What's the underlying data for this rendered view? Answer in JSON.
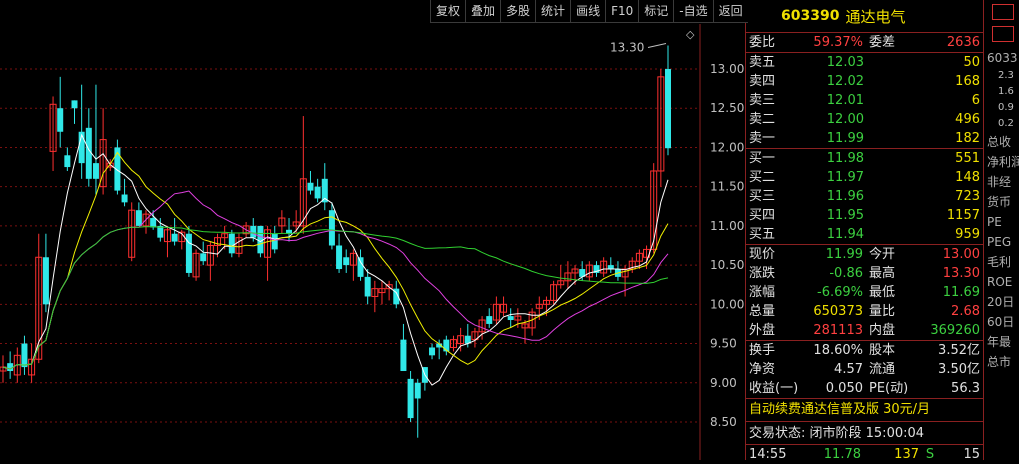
{
  "toolbar": [
    "复权",
    "叠加",
    "多股",
    "统计",
    "画线",
    "F10",
    "标记",
    "-自选",
    "返回"
  ],
  "chart_data": {
    "type": "candlestick",
    "ylim": [
      8.3,
      13.6
    ],
    "yticks": [
      "13.00",
      "12.50",
      "12.00",
      "11.50",
      "11.00",
      "10.50",
      "10.00",
      "9.50",
      "9.00",
      "8.50"
    ],
    "high_annotation": "13.30",
    "candles": [
      [
        9.15,
        9.35,
        9.0,
        9.2
      ],
      [
        9.25,
        9.4,
        9.05,
        9.15
      ],
      [
        9.1,
        9.45,
        9.0,
        9.35
      ],
      [
        9.5,
        9.6,
        9.1,
        9.2
      ],
      [
        9.1,
        9.5,
        9.0,
        9.3
      ],
      [
        9.3,
        10.9,
        9.25,
        10.6
      ],
      [
        10.6,
        10.9,
        9.9,
        10.0
      ],
      [
        11.95,
        12.65,
        11.7,
        12.55
      ],
      [
        12.5,
        12.9,
        12.0,
        12.2
      ],
      [
        11.9,
        12.0,
        11.7,
        11.75
      ],
      [
        12.6,
        12.6,
        12.3,
        12.5
      ],
      [
        12.2,
        12.8,
        11.6,
        11.8
      ],
      [
        12.25,
        12.5,
        11.5,
        11.6
      ],
      [
        11.8,
        12.8,
        11.4,
        11.6
      ],
      [
        11.5,
        12.5,
        11.4,
        12.1
      ],
      [
        11.75,
        11.85,
        11.7,
        11.8
      ],
      [
        12.0,
        12.1,
        11.4,
        11.45
      ],
      [
        11.4,
        11.6,
        11.25,
        11.3
      ],
      [
        10.6,
        11.3,
        10.55,
        11.2
      ],
      [
        11.2,
        11.3,
        11.0,
        11.0
      ],
      [
        11.0,
        11.2,
        10.9,
        11.15
      ],
      [
        11.1,
        11.2,
        10.95,
        10.98
      ],
      [
        11.0,
        11.1,
        10.8,
        10.85
      ],
      [
        10.8,
        11.0,
        10.6,
        10.95
      ],
      [
        10.9,
        11.1,
        10.75,
        10.8
      ],
      [
        10.8,
        10.95,
        10.7,
        10.92
      ],
      [
        10.9,
        11.0,
        10.35,
        10.4
      ],
      [
        10.35,
        10.7,
        10.3,
        10.65
      ],
      [
        10.65,
        10.8,
        10.5,
        10.55
      ],
      [
        10.5,
        10.8,
        10.3,
        10.75
      ],
      [
        10.75,
        10.9,
        10.6,
        10.85
      ],
      [
        10.85,
        11.0,
        10.7,
        10.9
      ],
      [
        10.9,
        10.95,
        10.6,
        10.65
      ],
      [
        10.65,
        10.9,
        10.6,
        10.85
      ],
      [
        10.9,
        11.05,
        10.85,
        11.0
      ],
      [
        11.0,
        11.1,
        10.8,
        10.85
      ],
      [
        11.0,
        11.0,
        10.6,
        10.65
      ],
      [
        10.6,
        11.0,
        10.3,
        10.95
      ],
      [
        10.9,
        11.0,
        10.65,
        10.7
      ],
      [
        11.0,
        11.2,
        10.9,
        11.1
      ],
      [
        10.95,
        11.1,
        10.8,
        10.9
      ],
      [
        11.0,
        11.2,
        10.9,
        11.05
      ],
      [
        11.0,
        12.4,
        10.9,
        11.6
      ],
      [
        11.55,
        11.7,
        11.4,
        11.45
      ],
      [
        11.5,
        11.6,
        11.3,
        11.35
      ],
      [
        11.6,
        11.8,
        11.2,
        11.3
      ],
      [
        11.2,
        11.3,
        10.7,
        10.75
      ],
      [
        10.75,
        10.9,
        10.4,
        10.45
      ],
      [
        10.6,
        10.7,
        10.4,
        10.5
      ],
      [
        10.5,
        10.7,
        10.3,
        10.65
      ],
      [
        10.6,
        10.7,
        10.3,
        10.35
      ],
      [
        10.35,
        10.45,
        10.0,
        10.1
      ],
      [
        10.1,
        10.3,
        9.9,
        10.2
      ],
      [
        10.15,
        10.3,
        10.0,
        10.2
      ],
      [
        10.2,
        10.3,
        10.05,
        10.25
      ],
      [
        10.2,
        10.3,
        9.95,
        10.0
      ],
      [
        9.55,
        9.75,
        9.15,
        9.15
      ],
      [
        9.05,
        9.15,
        8.5,
        8.55
      ],
      [
        9.0,
        9.05,
        8.3,
        8.8
      ],
      [
        9.2,
        9.2,
        8.9,
        9.0
      ],
      [
        9.45,
        9.5,
        9.3,
        9.35
      ],
      [
        9.5,
        9.55,
        9.3,
        9.45
      ],
      [
        9.55,
        9.6,
        9.35,
        9.4
      ],
      [
        9.45,
        9.6,
        9.4,
        9.55
      ],
      [
        9.5,
        9.7,
        9.4,
        9.6
      ],
      [
        9.6,
        9.75,
        9.45,
        9.5
      ],
      [
        9.55,
        9.7,
        9.45,
        9.65
      ],
      [
        9.65,
        9.85,
        9.55,
        9.8
      ],
      [
        9.85,
        9.95,
        9.7,
        9.75
      ],
      [
        9.8,
        10.1,
        9.75,
        10.0
      ],
      [
        9.9,
        10.1,
        9.85,
        10.0
      ],
      [
        9.85,
        9.95,
        9.7,
        9.8
      ],
      [
        9.8,
        9.95,
        9.7,
        9.85
      ],
      [
        9.7,
        9.8,
        9.5,
        9.75
      ],
      [
        9.7,
        9.95,
        9.6,
        9.9
      ],
      [
        9.95,
        10.1,
        9.8,
        10.0
      ],
      [
        10.0,
        10.1,
        9.85,
        10.05
      ],
      [
        10.05,
        10.3,
        10.0,
        10.25
      ],
      [
        10.25,
        10.5,
        10.2,
        10.3
      ],
      [
        10.3,
        10.55,
        10.2,
        10.4
      ],
      [
        10.4,
        10.5,
        10.25,
        10.45
      ],
      [
        10.45,
        10.55,
        10.3,
        10.35
      ],
      [
        10.35,
        10.55,
        10.3,
        10.5
      ],
      [
        10.5,
        10.55,
        10.35,
        10.4
      ],
      [
        10.4,
        10.6,
        10.35,
        10.55
      ],
      [
        10.5,
        10.6,
        10.4,
        10.45
      ],
      [
        10.45,
        10.55,
        10.3,
        10.35
      ],
      [
        10.35,
        10.5,
        10.1,
        10.45
      ],
      [
        10.45,
        10.6,
        10.4,
        10.55
      ],
      [
        10.55,
        10.7,
        10.45,
        10.65
      ],
      [
        10.6,
        10.75,
        10.45,
        10.7
      ],
      [
        10.7,
        11.8,
        10.65,
        11.7
      ],
      [
        11.7,
        13.0,
        11.5,
        12.9
      ],
      [
        13.0,
        13.3,
        11.9,
        11.99
      ]
    ]
  },
  "quote": {
    "code": "603390",
    "name": "通达电气",
    "weibi_label": "委比",
    "weibi_value": "59.37%",
    "weicha_label": "委差",
    "weicha_value": "2636",
    "asks": [
      {
        "label": "卖五",
        "price": "12.03",
        "vol": "50"
      },
      {
        "label": "卖四",
        "price": "12.02",
        "vol": "168"
      },
      {
        "label": "卖三",
        "price": "12.01",
        "vol": "6"
      },
      {
        "label": "卖二",
        "price": "12.00",
        "vol": "496"
      },
      {
        "label": "卖一",
        "price": "11.99",
        "vol": "182"
      }
    ],
    "bids": [
      {
        "label": "买一",
        "price": "11.98",
        "vol": "551"
      },
      {
        "label": "买二",
        "price": "11.97",
        "vol": "148"
      },
      {
        "label": "买三",
        "price": "11.96",
        "vol": "723"
      },
      {
        "label": "买四",
        "price": "11.95",
        "vol": "1157"
      },
      {
        "label": "买五",
        "price": "11.94",
        "vol": "959"
      }
    ],
    "stats": [
      {
        "l1": "现价",
        "v1": "11.99",
        "c1": "green",
        "l2": "今开",
        "v2": "13.00",
        "c2": "red"
      },
      {
        "l1": "涨跌",
        "v1": "-0.86",
        "c1": "green",
        "l2": "最高",
        "v2": "13.30",
        "c2": "red"
      },
      {
        "l1": "涨幅",
        "v1": "-6.69%",
        "c1": "green",
        "l2": "最低",
        "v2": "11.69",
        "c2": "green"
      },
      {
        "l1": "总量",
        "v1": "650373",
        "c1": "yellow",
        "l2": "量比",
        "v2": "2.68",
        "c2": "red"
      },
      {
        "l1": "外盘",
        "v1": "281113",
        "c1": "red",
        "l2": "内盘",
        "v2": "369260",
        "c2": "green"
      }
    ],
    "stats2": [
      {
        "l1": "换手",
        "v1": "18.60%",
        "l2": "股本",
        "v2": "3.52亿"
      },
      {
        "l1": "净资",
        "v1": "4.57",
        "l2": "流通",
        "v2": "3.50亿"
      },
      {
        "l1": "收益(一)",
        "v1": "0.050",
        "l2": "PE(动)",
        "v2": "56.3"
      }
    ],
    "ad": "自动续费通达信普及版 30元/月",
    "trade_status": "交易状态: 闭市阶段 15:00:04",
    "tick": {
      "time": "14:55",
      "price": "11.78",
      "vol": "137",
      "side": "S",
      "count": "15"
    }
  },
  "side": {
    "code": "6033",
    "scale": [
      "2.3",
      "1.6",
      "0.9",
      "0.2"
    ],
    "labels": [
      "总收",
      "净利润",
      "非经",
      "货币",
      "PE",
      "PEG",
      "毛利",
      "ROE",
      "20日",
      "60日",
      "年最",
      "总市"
    ]
  }
}
